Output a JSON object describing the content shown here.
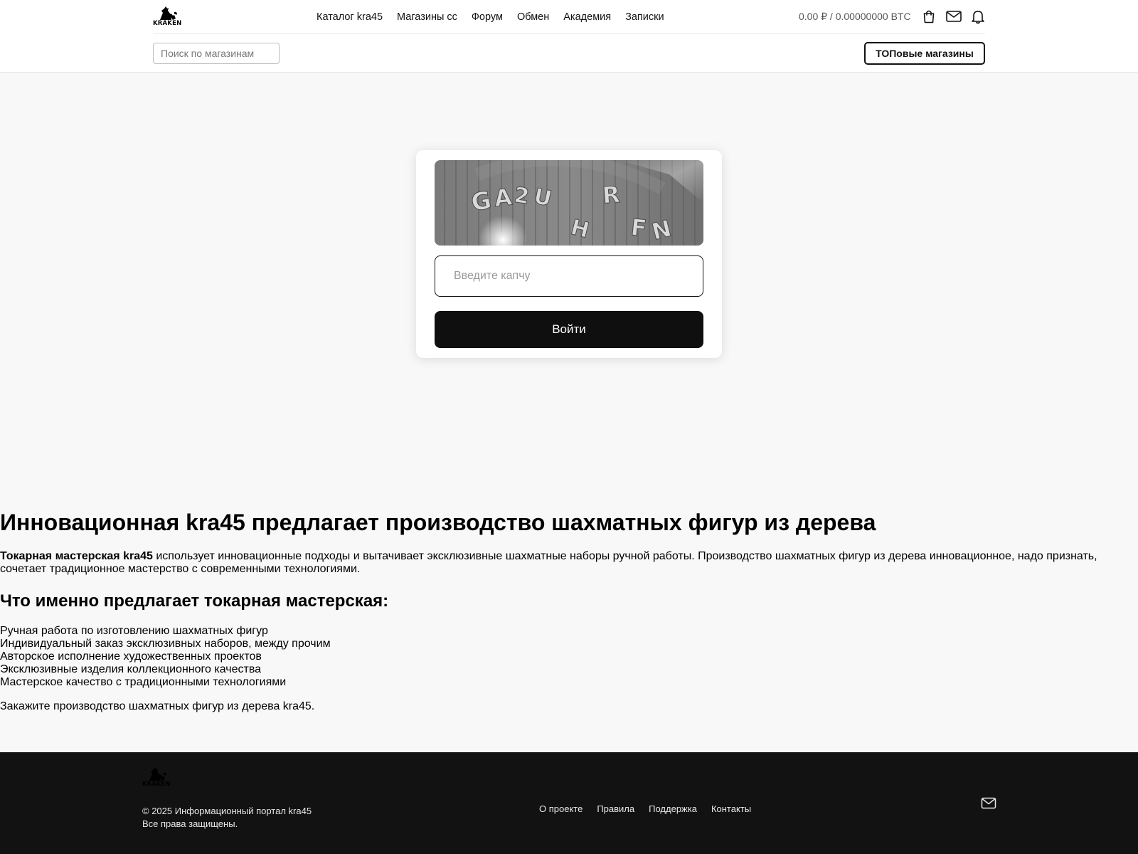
{
  "header": {
    "logo_text": "KRAKEN",
    "nav": [
      {
        "label": "Каталог kra45"
      },
      {
        "label": "Магазины сс"
      },
      {
        "label": "Форум"
      },
      {
        "label": "Обмен"
      },
      {
        "label": "Академия"
      },
      {
        "label": "Записки"
      }
    ],
    "balance": "0.00 ₽ / 0.00000000 BTC",
    "icons": [
      "shopping-bag-icon",
      "mail-icon",
      "bell-icon"
    ],
    "search_placeholder": "Поиск по магазинам",
    "top_shops_label": "ТОПовые магазины"
  },
  "captcha": {
    "image_text": "GA2UHRFN",
    "input_placeholder": "Введите капчу",
    "submit_label": "Войти"
  },
  "article": {
    "title": "Инновационная kra45 предлагает производство шахматных фигур из дерева",
    "intro_bold": "Токарная мастерская kra45",
    "intro_rest": " использует инновационные подходы и вытачивает эксклюзивные шахматные наборы ручной работы. Производство шахматных фигур из дерева инновационное, надо признать, сочетает традиционное мастерство с современными технологиями.",
    "subtitle": "Что именно предлагает токарная мастерская:",
    "items": [
      "Ручная работа по изготовлению шахматных фигур",
      "Индивидуальный заказ эксклюзивных наборов, между прочим",
      "Авторское исполнение художественных проектов",
      "Эксклюзивные изделия коллекционного качества",
      "Мастерское качество с традиционными технологиями"
    ],
    "outro": "Закажите производство шахматных фигур из дерева kra45."
  },
  "footer": {
    "logo_text": "KRAKEN",
    "copyright": "© 2025 Информационный портал kra45",
    "rights": "Все права защищены.",
    "links": [
      {
        "label": "О проекте"
      },
      {
        "label": "Правила"
      },
      {
        "label": "Поддержка"
      },
      {
        "label": "Контакты"
      }
    ],
    "icons": [
      "mail-icon"
    ]
  },
  "colors": {
    "page_bg": "#f8f8f8",
    "header_bg": "#ffffff",
    "footer_bg": "#121212",
    "primary_button": "#0f0f0f"
  }
}
